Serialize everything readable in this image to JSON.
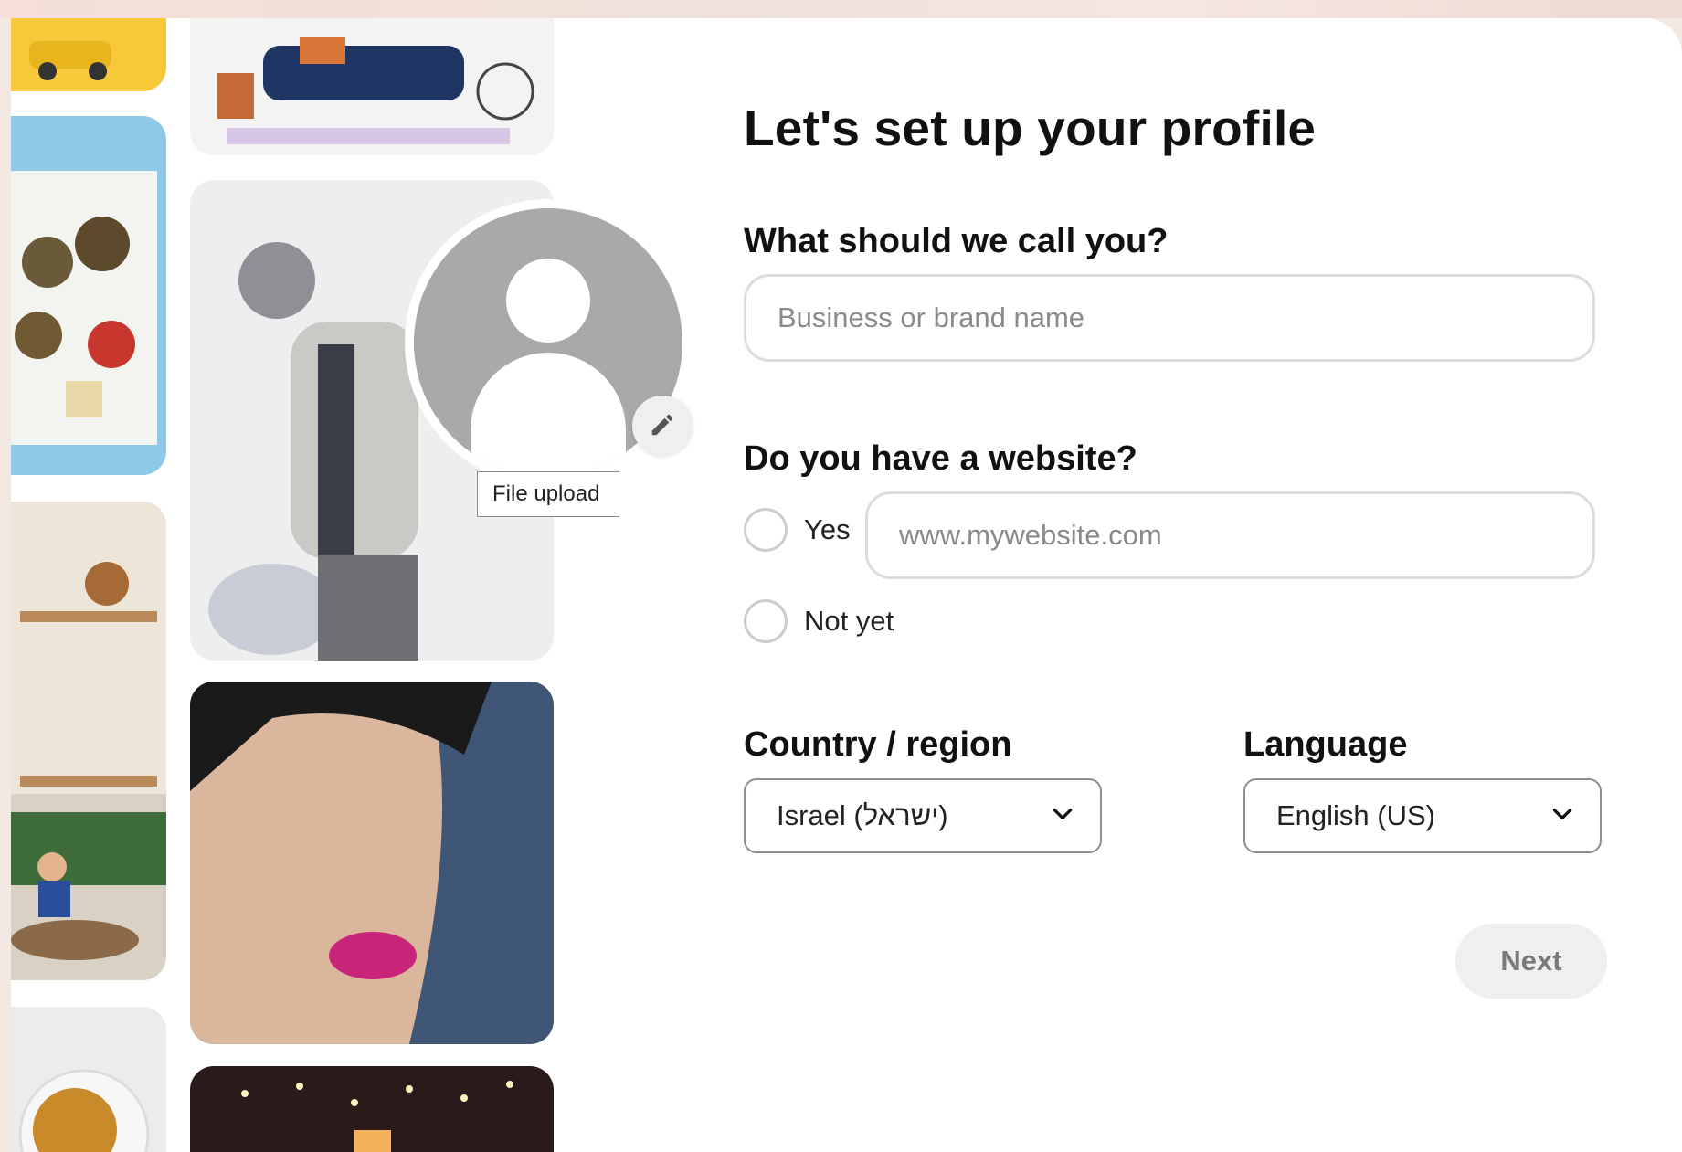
{
  "form": {
    "title": "Let's set up your profile",
    "name_question": "What should we call you?",
    "name_placeholder": "Business or brand name",
    "website_question": "Do you have a website?",
    "website_yes_label": "Yes",
    "website_placeholder": "www.mywebsite.com",
    "website_no_label": "Not yet",
    "country_label": "Country / region",
    "country_value": "Israel (ישראל)",
    "language_label": "Language",
    "language_value": "English (US)",
    "next_label": "Next"
  },
  "avatar": {
    "tooltip": "File upload"
  },
  "colors": {
    "background": "#ffffff",
    "avatar_gray": "#a9a9a9",
    "button_disabled_bg": "#efefef",
    "button_disabled_text": "#7a7a7a",
    "input_border": "#dcdcdc"
  },
  "icons": {
    "edit": "pencil-icon",
    "dropdown": "chevron-down-icon"
  }
}
